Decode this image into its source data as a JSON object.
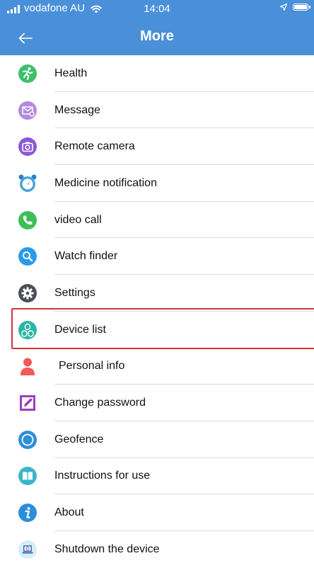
{
  "status_bar": {
    "carrier": "vodafone AU",
    "time": "14:04"
  },
  "header": {
    "title": "More",
    "back_icon": "arrow-left-icon",
    "background": "#4a90d9"
  },
  "menu": {
    "items": [
      {
        "label": "Health",
        "icon": "running-man-icon",
        "color": "#3cc06b"
      },
      {
        "label": "Message",
        "icon": "envelope-icon",
        "color": "#b38ae0"
      },
      {
        "label": "Remote camera",
        "icon": "camera-icon",
        "color": "#8b57d6"
      },
      {
        "label": "Medicine notification",
        "icon": "alarm-clock-icon",
        "color": "#4aa3df"
      },
      {
        "label": "video call",
        "icon": "phone-icon",
        "color": "#3cbf58"
      },
      {
        "label": "Watch finder",
        "icon": "magnifier-icon",
        "color": "#2a9be8"
      },
      {
        "label": "Settings",
        "icon": "gear-icon",
        "color": "#4a4f57"
      },
      {
        "label": "Device list",
        "icon": "device-list-icon",
        "color": "#2bb6a3",
        "highlighted": true
      },
      {
        "label": "Personal info",
        "icon": "person-icon",
        "color": "#f05a5a"
      },
      {
        "label": "Change password",
        "icon": "pencil-icon",
        "color": "#9b3fbf"
      },
      {
        "label": "Geofence",
        "icon": "geofence-circle-icon",
        "color": "#2e8fd6"
      },
      {
        "label": "Instructions for use",
        "icon": "book-icon",
        "color": "#3bb6c7"
      },
      {
        "label": "About",
        "icon": "info-icon",
        "color": "#2a8fd8"
      },
      {
        "label": "Shutdown the device",
        "icon": "laptop-power-icon",
        "color": "#2e6db8"
      }
    ],
    "highlight_color": "#d5333c"
  }
}
